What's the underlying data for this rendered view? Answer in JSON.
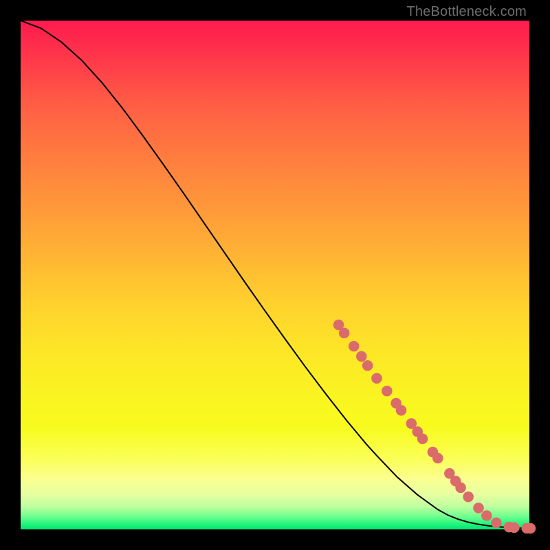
{
  "watermark": "TheBottleneck.com",
  "colors": {
    "curve_stroke": "#000000",
    "marker_fill": "#db6b6b",
    "background_top": "#ff1a4e",
    "background_bottom": "#00e673"
  },
  "chart_data": {
    "type": "line",
    "title": "",
    "xlabel": "",
    "ylabel": "",
    "xlim": [
      0,
      100
    ],
    "ylim": [
      0,
      100
    ],
    "grid": false,
    "legend": false,
    "series": [
      {
        "name": "curve",
        "stroke": "#000000",
        "x": [
          0,
          4,
          8,
          12,
          16,
          20,
          24,
          28,
          32,
          36,
          40,
          44,
          48,
          52,
          56,
          60,
          64,
          68,
          70,
          74,
          78,
          82,
          84,
          86,
          88,
          90,
          92,
          94,
          96,
          98,
          100
        ],
        "y": [
          100,
          98.5,
          95.8,
          92.2,
          87.8,
          82.8,
          77.4,
          71.8,
          66.1,
          60.3,
          54.5,
          48.7,
          43.0,
          37.4,
          31.9,
          26.6,
          21.5,
          16.7,
          14.5,
          10.3,
          6.8,
          3.9,
          2.8,
          2.0,
          1.4,
          1.0,
          0.7,
          0.5,
          0.35,
          0.25,
          0.2
        ]
      }
    ],
    "markers": [
      {
        "x": 62.5,
        "y": 40.2
      },
      {
        "x": 63.6,
        "y": 38.6
      },
      {
        "x": 65.5,
        "y": 36.0
      },
      {
        "x": 67.0,
        "y": 34.0
      },
      {
        "x": 68.2,
        "y": 32.2
      },
      {
        "x": 70.0,
        "y": 29.7
      },
      {
        "x": 72.0,
        "y": 27.2
      },
      {
        "x": 73.8,
        "y": 24.8
      },
      {
        "x": 74.8,
        "y": 23.4
      },
      {
        "x": 76.8,
        "y": 20.8
      },
      {
        "x": 78.0,
        "y": 19.2
      },
      {
        "x": 79.0,
        "y": 17.8
      },
      {
        "x": 81.0,
        "y": 15.2
      },
      {
        "x": 82.0,
        "y": 14.0
      },
      {
        "x": 84.3,
        "y": 11.0
      },
      {
        "x": 85.5,
        "y": 9.5
      },
      {
        "x": 86.5,
        "y": 8.2
      },
      {
        "x": 88.0,
        "y": 6.4
      },
      {
        "x": 90.0,
        "y": 4.2
      },
      {
        "x": 91.6,
        "y": 2.7
      },
      {
        "x": 93.5,
        "y": 1.3
      },
      {
        "x": 96.0,
        "y": 0.45
      },
      {
        "x": 97.0,
        "y": 0.35
      },
      {
        "x": 99.5,
        "y": 0.22
      },
      {
        "x": 100.2,
        "y": 0.2
      }
    ],
    "marker_style": {
      "radius": 1.05,
      "fill": "#db6b6b"
    }
  }
}
